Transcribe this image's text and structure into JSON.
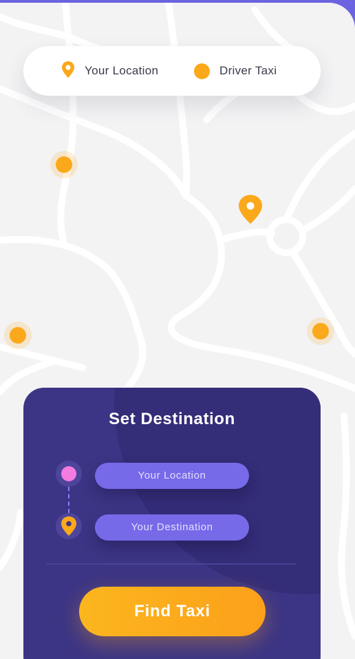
{
  "legend": {
    "location_label": "Your Location",
    "taxi_label": "Driver Taxi"
  },
  "panel": {
    "title": "Set Destination",
    "location_placeholder": "Your Location",
    "destination_placeholder": "Your Destination",
    "find_button_label": "Find Taxi"
  },
  "colors": {
    "accent_orange": "#fba81a",
    "panel_purple": "#3c3585",
    "field_purple": "#766ae9",
    "origin_pink": "#f47be0",
    "map_background": "#f3f3f4"
  },
  "icons": {
    "location_pin": "location-pin-icon",
    "taxi_marker": "taxi-dot-icon",
    "origin_marker": "origin-dot-icon"
  }
}
